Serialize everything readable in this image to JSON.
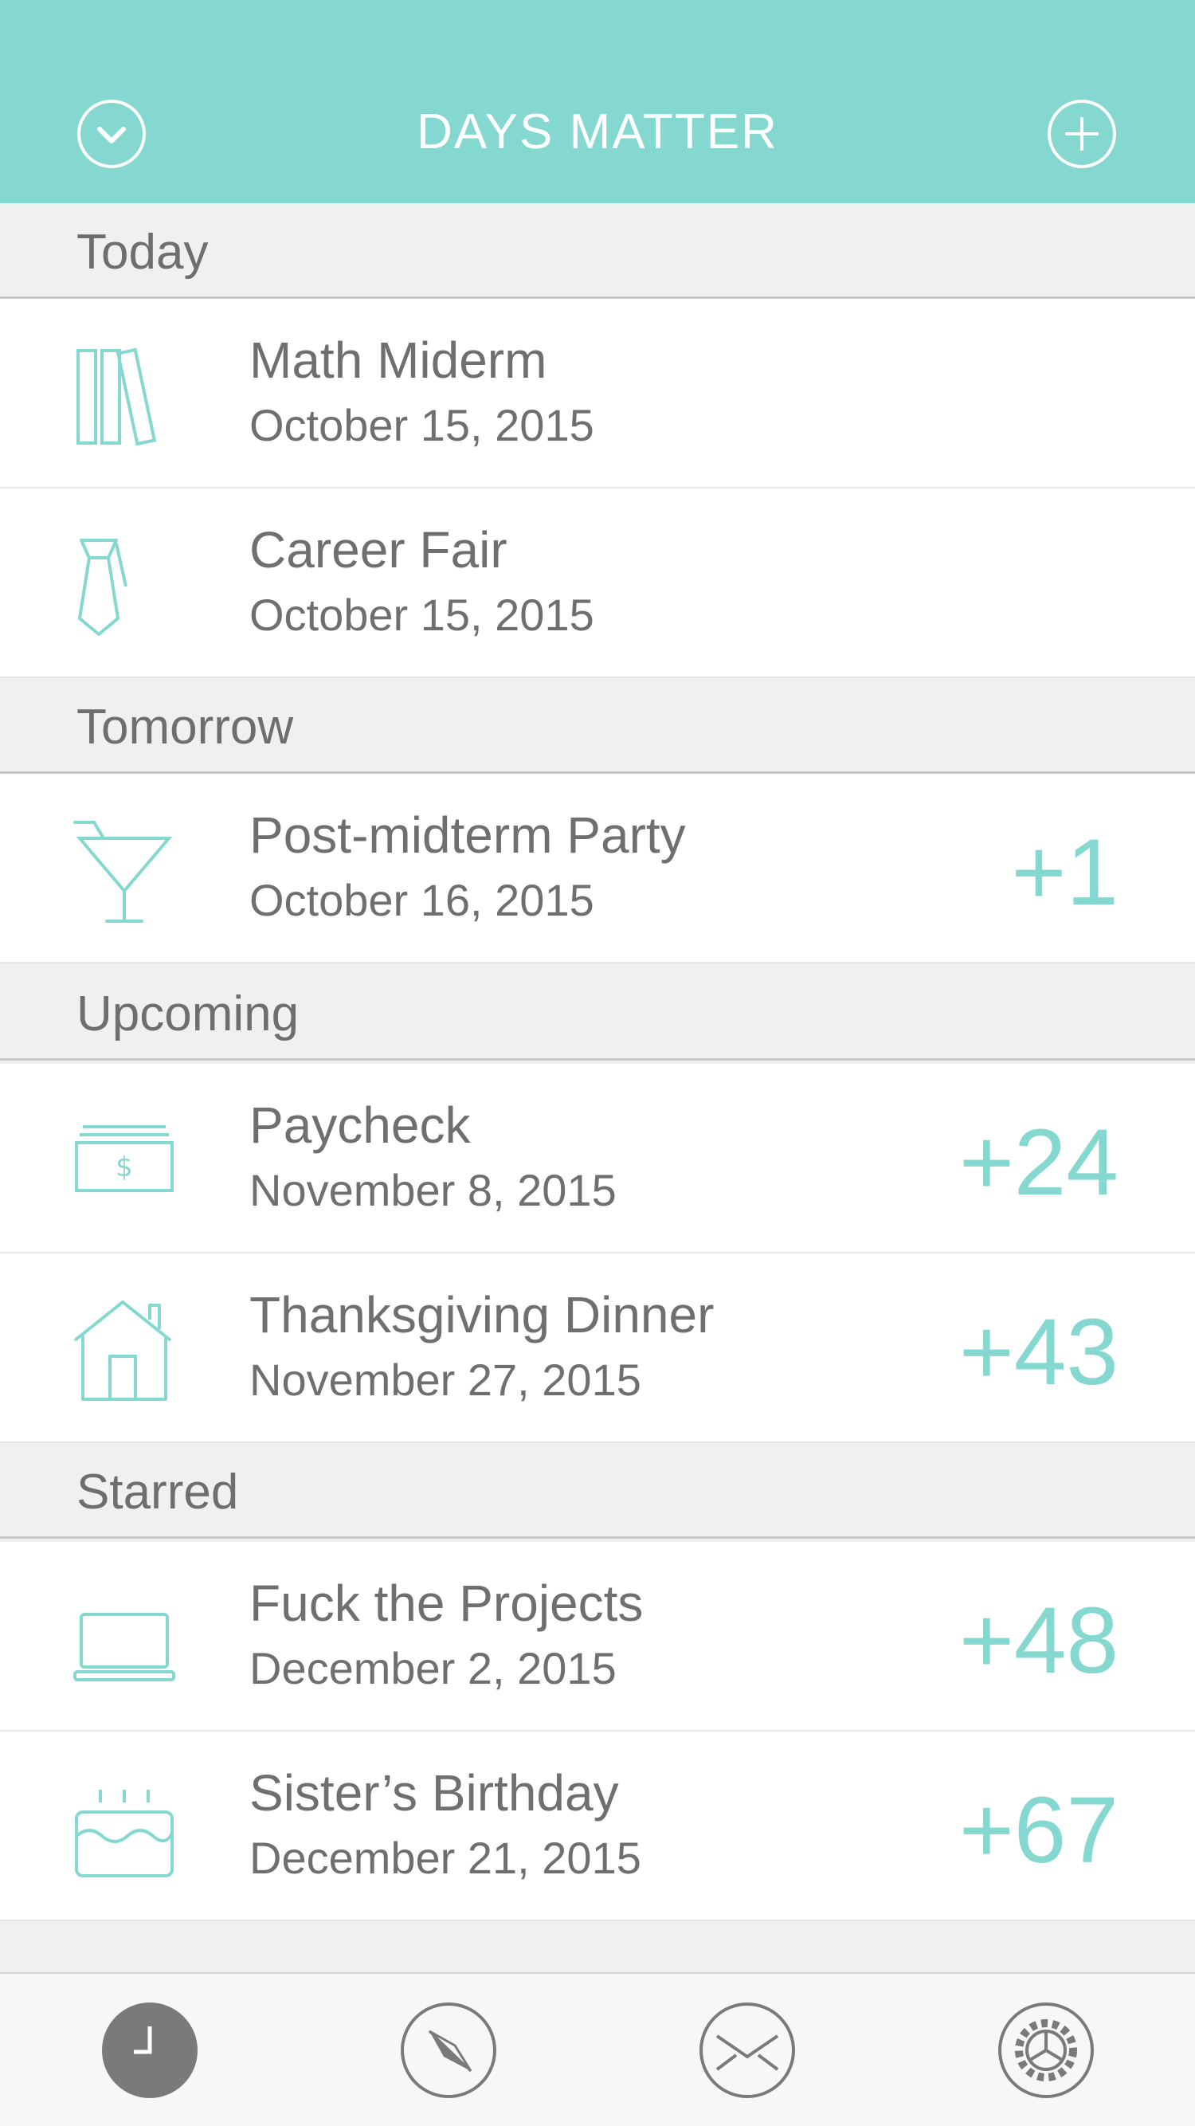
{
  "header": {
    "title": "DAYS MATTER",
    "left_icon": "chevron-down-circle-icon",
    "right_icon": "plus-circle-icon",
    "background": "#84d8cf"
  },
  "colors": {
    "accent": "#84d8cf",
    "text": "#6f6f6f",
    "section_bg": "#f0f0f0"
  },
  "sections": [
    {
      "label": "Today"
    },
    {
      "label": "Tomorrow"
    },
    {
      "label": "Upcoming"
    },
    {
      "label": "Starred"
    }
  ],
  "events": [
    {
      "name": "Math Miderm",
      "date": "October 15, 2015",
      "count": "",
      "icon": "books-icon"
    },
    {
      "name": "Career Fair",
      "date": "October 15, 2015",
      "count": "",
      "icon": "necktie-icon"
    },
    {
      "name": "Post-midterm Party",
      "date": "October 16, 2015",
      "count": "+1",
      "icon": "cocktail-icon"
    },
    {
      "name": "Paycheck",
      "date": "November 8, 2015",
      "count": "+24",
      "icon": "money-icon"
    },
    {
      "name": "Thanksgiving Dinner",
      "date": "November 27, 2015",
      "count": "+43",
      "icon": "house-icon"
    },
    {
      "name": "Fuck the Projects",
      "date": "December 2, 2015",
      "count": "+48",
      "icon": "laptop-icon"
    },
    {
      "name": "Sister’s Birthday",
      "date": "December 21, 2015",
      "count": "+67",
      "icon": "birthday-cake-icon"
    }
  ],
  "tabs": [
    {
      "icon": "clock-icon",
      "active": true
    },
    {
      "icon": "compass-icon",
      "active": false
    },
    {
      "icon": "envelope-icon",
      "active": false
    },
    {
      "icon": "settings-gear-icon",
      "active": false
    }
  ]
}
